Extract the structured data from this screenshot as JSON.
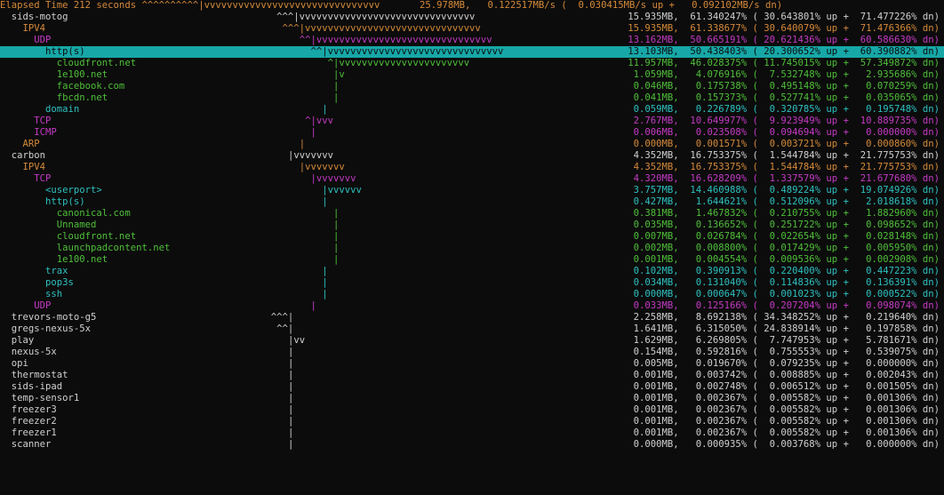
{
  "header": {
    "text": "Elapsed Time 212 seconds ^^^^^^^^^^|vvvvvvvvvvvvvvvvvvvvvvvvvvvvvvv       25.978MB,   0.122517MB/s (  0.030415MB/s up +   0.092102MB/s dn)"
  },
  "colors": {
    "header": "#d58a3a",
    "host": "#d0d0d0",
    "ipv4": "#d58a3a",
    "udp_tcp": "#c53ac5",
    "http": "#2ec0c0",
    "domain_leaf": "#4fbf3a"
  },
  "rows": [
    {
      "label": "  sids-motog",
      "bar": "^^^|vvvvvvvvvvvvvvvvvvvvvvvvvvvvvvv",
      "stats": "15.935MB,  61.340247% ( 30.643801% up +  71.477226% dn)",
      "color": "#d0d0d0",
      "barcol": 44
    },
    {
      "label": "    IPV4",
      "bar": "^^^|vvvvvvvvvvvvvvvvvvvvvvvvvvvvvvv",
      "stats": "15.935MB,  61.338677% ( 30.640079% up +  71.476366% dn)",
      "color": "#d58a3a",
      "barcol": 45
    },
    {
      "label": "      UDP",
      "bar": "^^|vvvvvvvvvvvvvvvvvvvvvvvvvvvvvvv",
      "stats": "13.162MB,  50.665191% ( 20.621436% up +  60.586630% dn)",
      "color": "#c53ac5",
      "barcol": 48
    },
    {
      "label": "        http(s)",
      "bar": "^^|vvvvvvvvvvvvvvvvvvvvvvvvvvvvvvv",
      "stats": "13.103MB,  50.438403% ( 20.300652% up +  60.390882% dn)",
      "color": "#0b0b0b",
      "barcol": 50,
      "selected": true
    },
    {
      "label": "          cloudfront.net",
      "bar": "^|vvvvvvvvvvvvvvvvvvvvvvv",
      "stats": "11.957MB,  46.028375% ( 11.745015% up +  57.349872% dn)",
      "color": "#4fbf3a",
      "barcol": 53
    },
    {
      "label": "          1e100.net",
      "bar": "|v",
      "stats": "1.059MB,   4.076916% (  7.532748% up +   2.935686% dn)",
      "color": "#4fbf3a",
      "barcol": 54
    },
    {
      "label": "          facebook.com",
      "bar": "|",
      "stats": "0.046MB,   0.175738% (  0.495148% up +   0.070259% dn)",
      "color": "#4fbf3a",
      "barcol": 54
    },
    {
      "label": "          fbcdn.net",
      "bar": "|",
      "stats": "0.041MB,   0.157373% (  0.527741% up +   0.035065% dn)",
      "color": "#4fbf3a",
      "barcol": 54
    },
    {
      "label": "        domain",
      "bar": "|",
      "stats": "0.059MB,   0.226789% (  0.320785% up +   0.195748% dn)",
      "color": "#2ec0c0",
      "barcol": 52
    },
    {
      "label": "      TCP",
      "bar": "^|vvv",
      "stats": "2.767MB,  10.649977% (  9.923949% up +  10.889735% dn)",
      "color": "#c53ac5",
      "barcol": 49
    },
    {
      "label": "      ICMP",
      "bar": "|",
      "stats": "0.006MB,   0.023508% (  0.094694% up +   0.000000% dn)",
      "color": "#c53ac5",
      "barcol": 50
    },
    {
      "label": "    ARP",
      "bar": "|",
      "stats": "0.000MB,   0.001571% (  0.003721% up +   0.000860% dn)",
      "color": "#d58a3a",
      "barcol": 48
    },
    {
      "label": "  carbon",
      "bar": "|vvvvvvv",
      "stats": "4.352MB,  16.753375% (  1.544784% up +  21.775753% dn)",
      "color": "#d0d0d0",
      "barcol": 46
    },
    {
      "label": "    IPV4",
      "bar": "|vvvvvvv",
      "stats": "4.352MB,  16.753375% (  1.544784% up +  21.775753% dn)",
      "color": "#d58a3a",
      "barcol": 48
    },
    {
      "label": "      TCP",
      "bar": "|vvvvvvv",
      "stats": "4.320MB,  16.628209% (  1.337579% up +  21.677680% dn)",
      "color": "#c53ac5",
      "barcol": 50
    },
    {
      "label": "        <userport>",
      "bar": "|vvvvvv",
      "stats": "3.757MB,  14.460988% (  0.489224% up +  19.074926% dn)",
      "color": "#2ec0c0",
      "barcol": 52
    },
    {
      "label": "        http(s)",
      "bar": "|",
      "stats": "0.427MB,   1.644621% (  0.512096% up +   2.018618% dn)",
      "color": "#2ec0c0",
      "barcol": 52
    },
    {
      "label": "          canonical.com",
      "bar": "|",
      "stats": "0.381MB,   1.467832% (  0.210755% up +   1.882960% dn)",
      "color": "#4fbf3a",
      "barcol": 54
    },
    {
      "label": "          Unnamed",
      "bar": "|",
      "stats": "0.035MB,   0.136652% (  0.251722% up +   0.098652% dn)",
      "color": "#4fbf3a",
      "barcol": 54
    },
    {
      "label": "          cloudfront.net",
      "bar": "|",
      "stats": "0.007MB,   0.026784% (  0.022654% up +   0.028148% dn)",
      "color": "#4fbf3a",
      "barcol": 54
    },
    {
      "label": "          launchpadcontent.net",
      "bar": "|",
      "stats": "0.002MB,   0.008800% (  0.017429% up +   0.005950% dn)",
      "color": "#4fbf3a",
      "barcol": 54
    },
    {
      "label": "          1e100.net",
      "bar": "|",
      "stats": "0.001MB,   0.004554% (  0.009536% up +   0.002908% dn)",
      "color": "#4fbf3a",
      "barcol": 54
    },
    {
      "label": "        trax",
      "bar": "|",
      "stats": "0.102MB,   0.390913% (  0.220400% up +   0.447223% dn)",
      "color": "#2ec0c0",
      "barcol": 52
    },
    {
      "label": "        pop3s",
      "bar": "|",
      "stats": "0.034MB,   0.131040% (  0.114836% up +   0.136391% dn)",
      "color": "#2ec0c0",
      "barcol": 52
    },
    {
      "label": "        ssh",
      "bar": "|",
      "stats": "0.000MB,   0.000647% (  0.001023% up +   0.000522% dn)",
      "color": "#2ec0c0",
      "barcol": 52
    },
    {
      "label": "      UDP",
      "bar": "|",
      "stats": "0.033MB,   0.125166% (  0.207204% up +   0.098074% dn)",
      "color": "#c53ac5",
      "barcol": 50
    },
    {
      "label": "  trevors-moto-g5",
      "bar": "^^^|",
      "stats": "2.258MB,   8.692138% ( 34.348252% up +   0.219640% dn)",
      "color": "#d0d0d0",
      "barcol": 43
    },
    {
      "label": "  gregs-nexus-5x",
      "bar": "^^|",
      "stats": "1.641MB,   6.315050% ( 24.838914% up +   0.197858% dn)",
      "color": "#d0d0d0",
      "barcol": 44
    },
    {
      "label": "  play",
      "bar": "|vv",
      "stats": "1.629MB,   6.269805% (  7.747953% up +   5.781671% dn)",
      "color": "#d0d0d0",
      "barcol": 46
    },
    {
      "label": "  nexus-5x",
      "bar": "|",
      "stats": "0.154MB,   0.592816% (  0.755553% up +   0.539075% dn)",
      "color": "#d0d0d0",
      "barcol": 46
    },
    {
      "label": "  opi",
      "bar": "|",
      "stats": "0.005MB,   0.019670% (  0.079235% up +   0.000000% dn)",
      "color": "#d0d0d0",
      "barcol": 46
    },
    {
      "label": "  thermostat",
      "bar": "|",
      "stats": "0.001MB,   0.003742% (  0.008885% up +   0.002043% dn)",
      "color": "#d0d0d0",
      "barcol": 46
    },
    {
      "label": "  sids-ipad",
      "bar": "|",
      "stats": "0.001MB,   0.002748% (  0.006512% up +   0.001505% dn)",
      "color": "#d0d0d0",
      "barcol": 46
    },
    {
      "label": "  temp-sensor1",
      "bar": "|",
      "stats": "0.001MB,   0.002367% (  0.005582% up +   0.001306% dn)",
      "color": "#d0d0d0",
      "barcol": 46
    },
    {
      "label": "  freezer3",
      "bar": "|",
      "stats": "0.001MB,   0.002367% (  0.005582% up +   0.001306% dn)",
      "color": "#d0d0d0",
      "barcol": 46
    },
    {
      "label": "  freezer2",
      "bar": "|",
      "stats": "0.001MB,   0.002367% (  0.005582% up +   0.001306% dn)",
      "color": "#d0d0d0",
      "barcol": 46
    },
    {
      "label": "  freezer1",
      "bar": "|",
      "stats": "0.001MB,   0.002367% (  0.005582% up +   0.001306% dn)",
      "color": "#d0d0d0",
      "barcol": 46
    },
    {
      "label": "  scanner",
      "bar": "|",
      "stats": "0.000MB,   0.000935% (  0.003768% up +   0.000000% dn)",
      "color": "#d0d0d0",
      "barcol": 46
    }
  ]
}
